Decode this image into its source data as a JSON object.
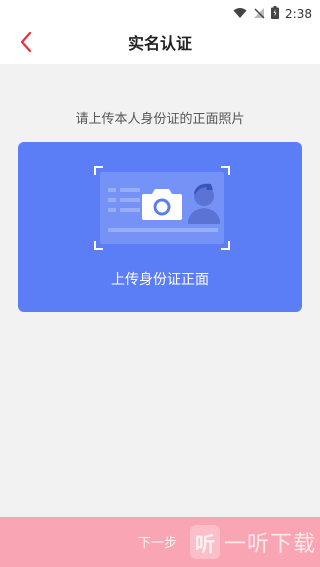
{
  "status_bar": {
    "time": "2:38"
  },
  "nav": {
    "title": "实名认证",
    "back_icon": "chevron-left-icon",
    "accent_color": "#e6333b"
  },
  "content": {
    "instruction": "请上传本人身份证的正面照片",
    "upload_card": {
      "label": "上传身份证正面",
      "icon": "camera-icon",
      "color": "#5b7ef6"
    }
  },
  "bottom": {
    "next_label": "下一步",
    "color": "#f9a5b3"
  },
  "watermark": {
    "logo_char": "听",
    "text": "一听下载"
  }
}
